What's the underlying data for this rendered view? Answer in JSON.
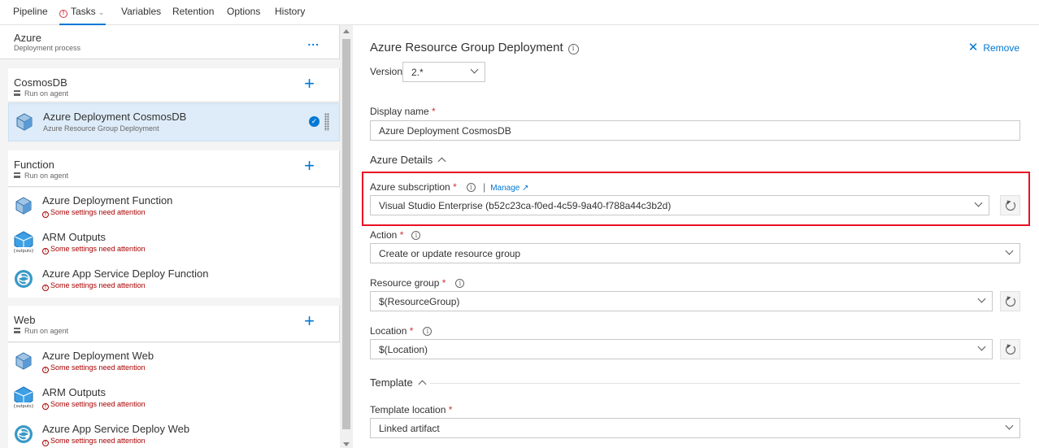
{
  "nav": {
    "tabs": [
      {
        "label": "Pipeline"
      },
      {
        "label": "Tasks"
      },
      {
        "label": "Variables"
      },
      {
        "label": "Retention"
      },
      {
        "label": "Options"
      },
      {
        "label": "History"
      }
    ],
    "active_tab": "Tasks",
    "tasks_has_warning": true
  },
  "left": {
    "root": {
      "title": "Azure",
      "subtitle": "Deployment process",
      "more": "..."
    },
    "phases": [
      {
        "title": "CosmosDB",
        "subtitle": "Run on agent",
        "tasks": [
          {
            "name": "Azure Deployment CosmosDB",
            "sub": "Azure Resource Group Deployment",
            "icon": "cube-icon",
            "selected": true
          }
        ]
      },
      {
        "title": "Function",
        "subtitle": "Run on agent",
        "tasks": [
          {
            "name": "Azure Deployment Function",
            "sub": "Some settings need attention",
            "icon": "cube-icon"
          },
          {
            "name": "ARM Outputs",
            "sub": "Some settings need attention",
            "icon": "outputs-icon"
          },
          {
            "name": "Azure App Service Deploy Function",
            "sub": "Some settings need attention",
            "icon": "app-service-icon"
          }
        ]
      },
      {
        "title": "Web",
        "subtitle": "Run on agent",
        "tasks": [
          {
            "name": "Azure Deployment Web",
            "sub": "Some settings need attention",
            "icon": "cube-icon"
          },
          {
            "name": "ARM Outputs",
            "sub": "Some settings need attention",
            "icon": "outputs-icon"
          },
          {
            "name": "Azure App Service Deploy Web",
            "sub": "Some settings need attention",
            "icon": "app-service-icon"
          }
        ]
      }
    ]
  },
  "right": {
    "title": "Azure Resource Group Deployment",
    "remove_label": "Remove",
    "version_label": "Version",
    "version_value": "2.*",
    "display_name_label": "Display name",
    "display_name_value": "Azure Deployment CosmosDB",
    "azure_details_label": "Azure Details",
    "subscription_label": "Azure subscription",
    "manage_label": "Manage",
    "subscription_value": "Visual Studio Enterprise (b52c23ca-f0ed-4c59-9a40-f788a44c3b2d)",
    "action_label": "Action",
    "action_value": "Create or update resource group",
    "resource_group_label": "Resource group",
    "resource_group_value": "$(ResourceGroup)",
    "location_label": "Location",
    "location_value": "$(Location)",
    "template_section_label": "Template",
    "template_location_label": "Template location",
    "template_location_value": "Linked artifact",
    "required_mark": "*",
    "separator": "|"
  },
  "colors": {
    "accent": "#0078d4",
    "error": "#a80000",
    "highlight": "#e81123"
  }
}
